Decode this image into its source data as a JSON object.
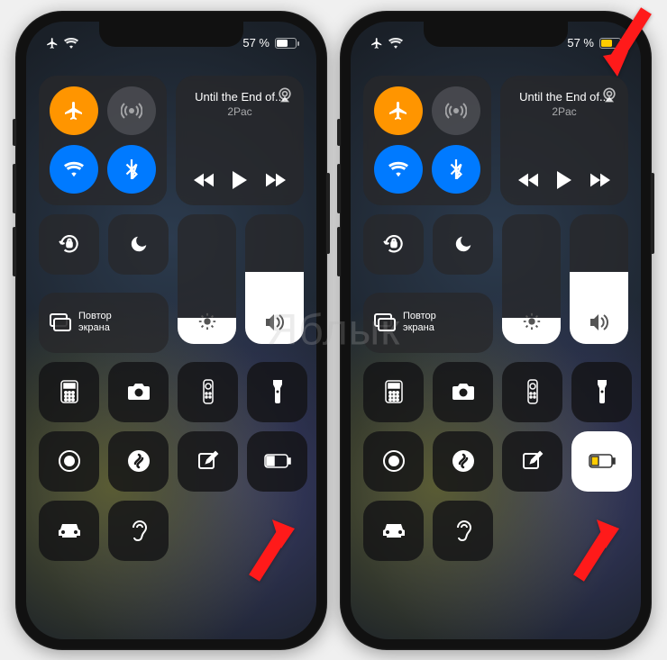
{
  "watermark": "Яблык",
  "phones": [
    {
      "battery_percent": "57 %",
      "battery_color": "#ffffff",
      "low_power_active": false
    },
    {
      "battery_percent": "57 %",
      "battery_color": "#ffcc00",
      "low_power_active": true
    }
  ],
  "status": {
    "airplane_active": true
  },
  "connectivity": {
    "airplane": {
      "color": "#ff9500"
    },
    "cellular": {
      "color_inactive": "rgba(120,120,128,.4)"
    },
    "wifi": {
      "color": "#007aff"
    },
    "bluetooth": {
      "color": "#007aff"
    }
  },
  "media": {
    "title": "Until the End of...",
    "artist": "2Pac"
  },
  "screen_mirroring": {
    "label_line1": "Повтор",
    "label_line2": "экрана"
  },
  "sliders": {
    "brightness_pct": 20,
    "volume_pct": 55
  },
  "controls": {
    "orientation_lock": "lock-rotation-icon",
    "dnd": "moon-icon",
    "calculator": "calculator-icon",
    "camera": "camera-icon",
    "remote": "remote-icon",
    "flashlight": "flashlight-icon",
    "record": "record-icon",
    "shazam": "shazam-icon",
    "notes": "compose-icon",
    "low_power": "battery-icon",
    "car": "car-icon",
    "hearing": "ear-icon"
  }
}
